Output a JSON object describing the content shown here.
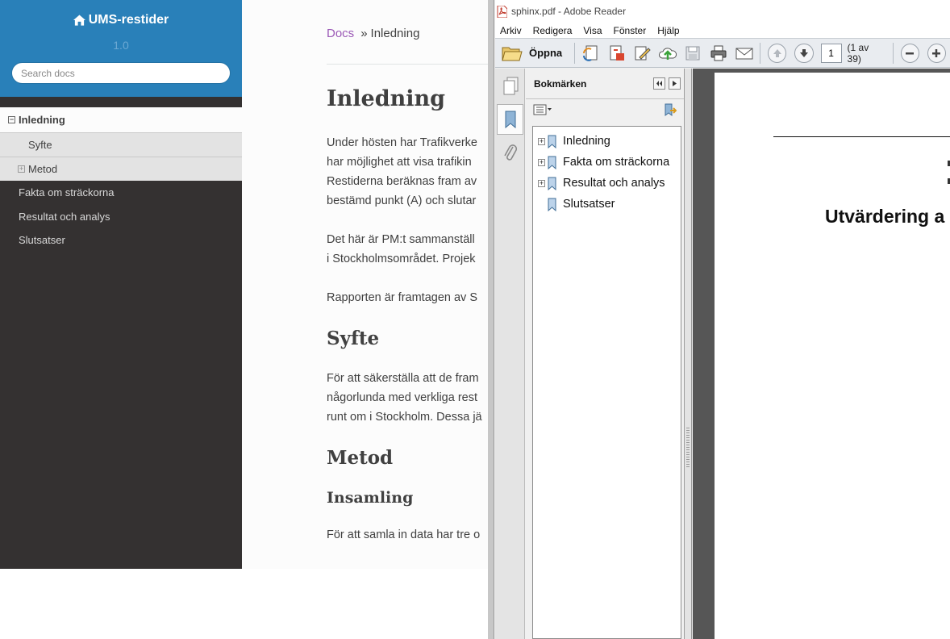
{
  "docs": {
    "project": "UMS-restider",
    "version": "1.0",
    "search_placeholder": "Search docs",
    "nav": {
      "current": "Inledning",
      "sub": [
        "Syfte",
        "Metod"
      ],
      "items": [
        "Fakta om sträckorna",
        "Resultat och analys",
        "Slutsatser"
      ]
    },
    "breadcrumb": {
      "home": "Docs",
      "separator": "»",
      "current": "Inledning"
    },
    "title": "Inledning",
    "paragraphs": [
      [
        "Under hösten har Trafikverke",
        "har möjlighet att visa trafikin",
        "Restiderna beräknas fram av",
        "bestämd punkt (A) och slutar"
      ],
      [
        "Det här är PM:t sammanställ",
        "i Stockholmsområdet. Projek"
      ],
      [
        "Rapporten är framtagen av S"
      ]
    ],
    "syfte_heading": "Syfte",
    "syfte_para": [
      "För att säkerställa att de fram",
      "någorlunda med verkliga rest",
      "runt om i Stockholm. Dessa jä"
    ],
    "metod_heading": "Metod",
    "insamling_heading": "Insamling",
    "insamling_para": "För att samla in data har tre o"
  },
  "reader": {
    "title": "sphinx.pdf - Adobe Reader",
    "menu": [
      "Arkiv",
      "Redigera",
      "Visa",
      "Fönster",
      "Hjälp"
    ],
    "open_label": "Öppna",
    "page_value": "1",
    "page_count": "(1 av 39)",
    "panel_title": "Bokmärken",
    "bookmarks": [
      {
        "label": "Inledning",
        "expandable": true
      },
      {
        "label": "Fakta om sträckorna",
        "expandable": true
      },
      {
        "label": "Resultat och analys",
        "expandable": true
      },
      {
        "label": "Slutsatser",
        "expandable": false
      }
    ],
    "pdf_title": "Utvärdering a"
  }
}
